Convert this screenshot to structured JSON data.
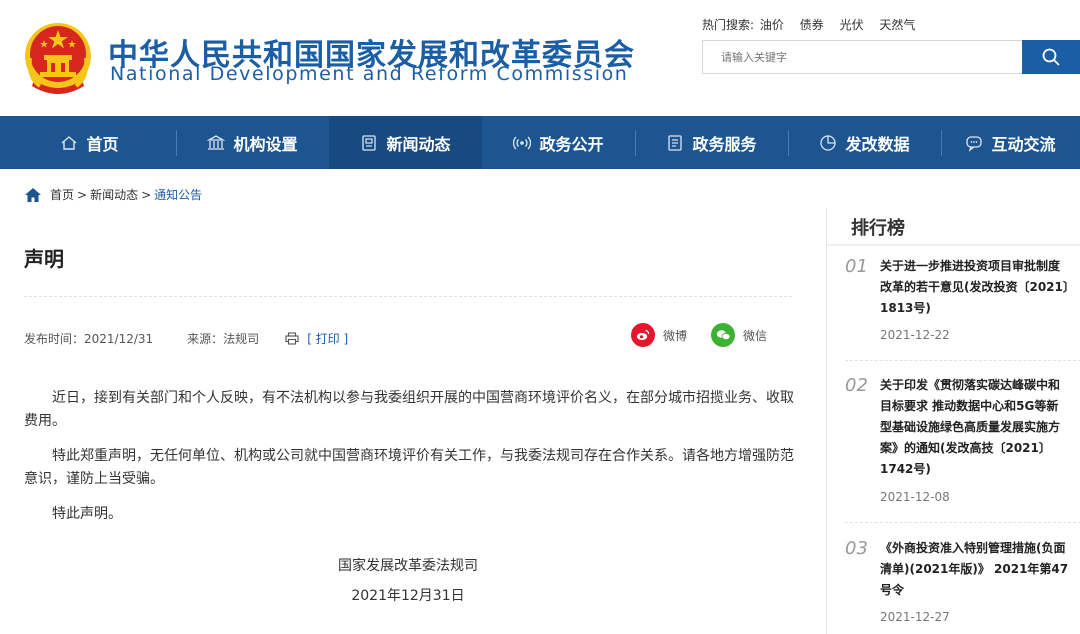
{
  "header": {
    "title_cn": "中华人民共和国国家发展和改革委员会",
    "title_en": "National Development and Reform Commission",
    "hot_label": "热门搜索:",
    "hot_words": [
      "油价",
      "债券",
      "光伏",
      "天然气"
    ],
    "search_placeholder": "请输入关键字"
  },
  "nav": [
    {
      "label": "首页",
      "icon": "home-icon"
    },
    {
      "label": "机构设置",
      "icon": "building-icon"
    },
    {
      "label": "新闻动态",
      "icon": "news-icon",
      "active": true
    },
    {
      "label": "政务公开",
      "icon": "broadcast-icon"
    },
    {
      "label": "政务服务",
      "icon": "document-icon"
    },
    {
      "label": "发改数据",
      "icon": "pie-chart-icon"
    },
    {
      "label": "互动交流",
      "icon": "chat-icon"
    }
  ],
  "breadcrumb": {
    "items": [
      "首页",
      "新闻动态",
      "通知公告"
    ],
    "separator": ">"
  },
  "article": {
    "title": "声明",
    "publish_time": "发布时间：2021/12/31",
    "source": "来源：法规司",
    "print_label": "[ 打印 ]",
    "share_weibo": "微博",
    "share_wechat": "微信",
    "paragraphs": [
      "近日，接到有关部门和个人反映，有不法机构以参与我委组织开展的中国营商环境评价名义，在部分城市招揽业务、收取费用。",
      "特此郑重声明，无任何单位、机构或公司就中国营商环境评价有关工作，与我委法规司存在合作关系。请各地方增强防范意识，谨防上当受骗。",
      "特此声明。"
    ],
    "signature": "国家发展改革委法规司",
    "sign_date": "2021年12月31日"
  },
  "sidebar": {
    "title": "排行榜",
    "items": [
      {
        "num": "01",
        "title": "关于进一步推进投资项目审批制度改革的若干意见(发改投资〔2021〕1813号)",
        "date": "2021-12-22"
      },
      {
        "num": "02",
        "title": "关于印发《贯彻落实碳达峰碳中和目标要求 推动数据中心和5G等新型基础设施绿色高质量发展实施方案》的通知(发改高技〔2021〕1742号)",
        "date": "2021-12-08"
      },
      {
        "num": "03",
        "title": "《外商投资准入特别管理措施(负面清单)(2021年版)》 2021年第47号令",
        "date": "2021-12-27"
      }
    ]
  },
  "colors": {
    "brand_blue": "#1b5ea6",
    "nav_bg": "#1d5590",
    "nav_active": "#174a80",
    "emblem_red": "#d7261e",
    "emblem_gold": "#f5c518",
    "weibo_red": "#e6162d",
    "wechat_green": "#3eb135"
  }
}
